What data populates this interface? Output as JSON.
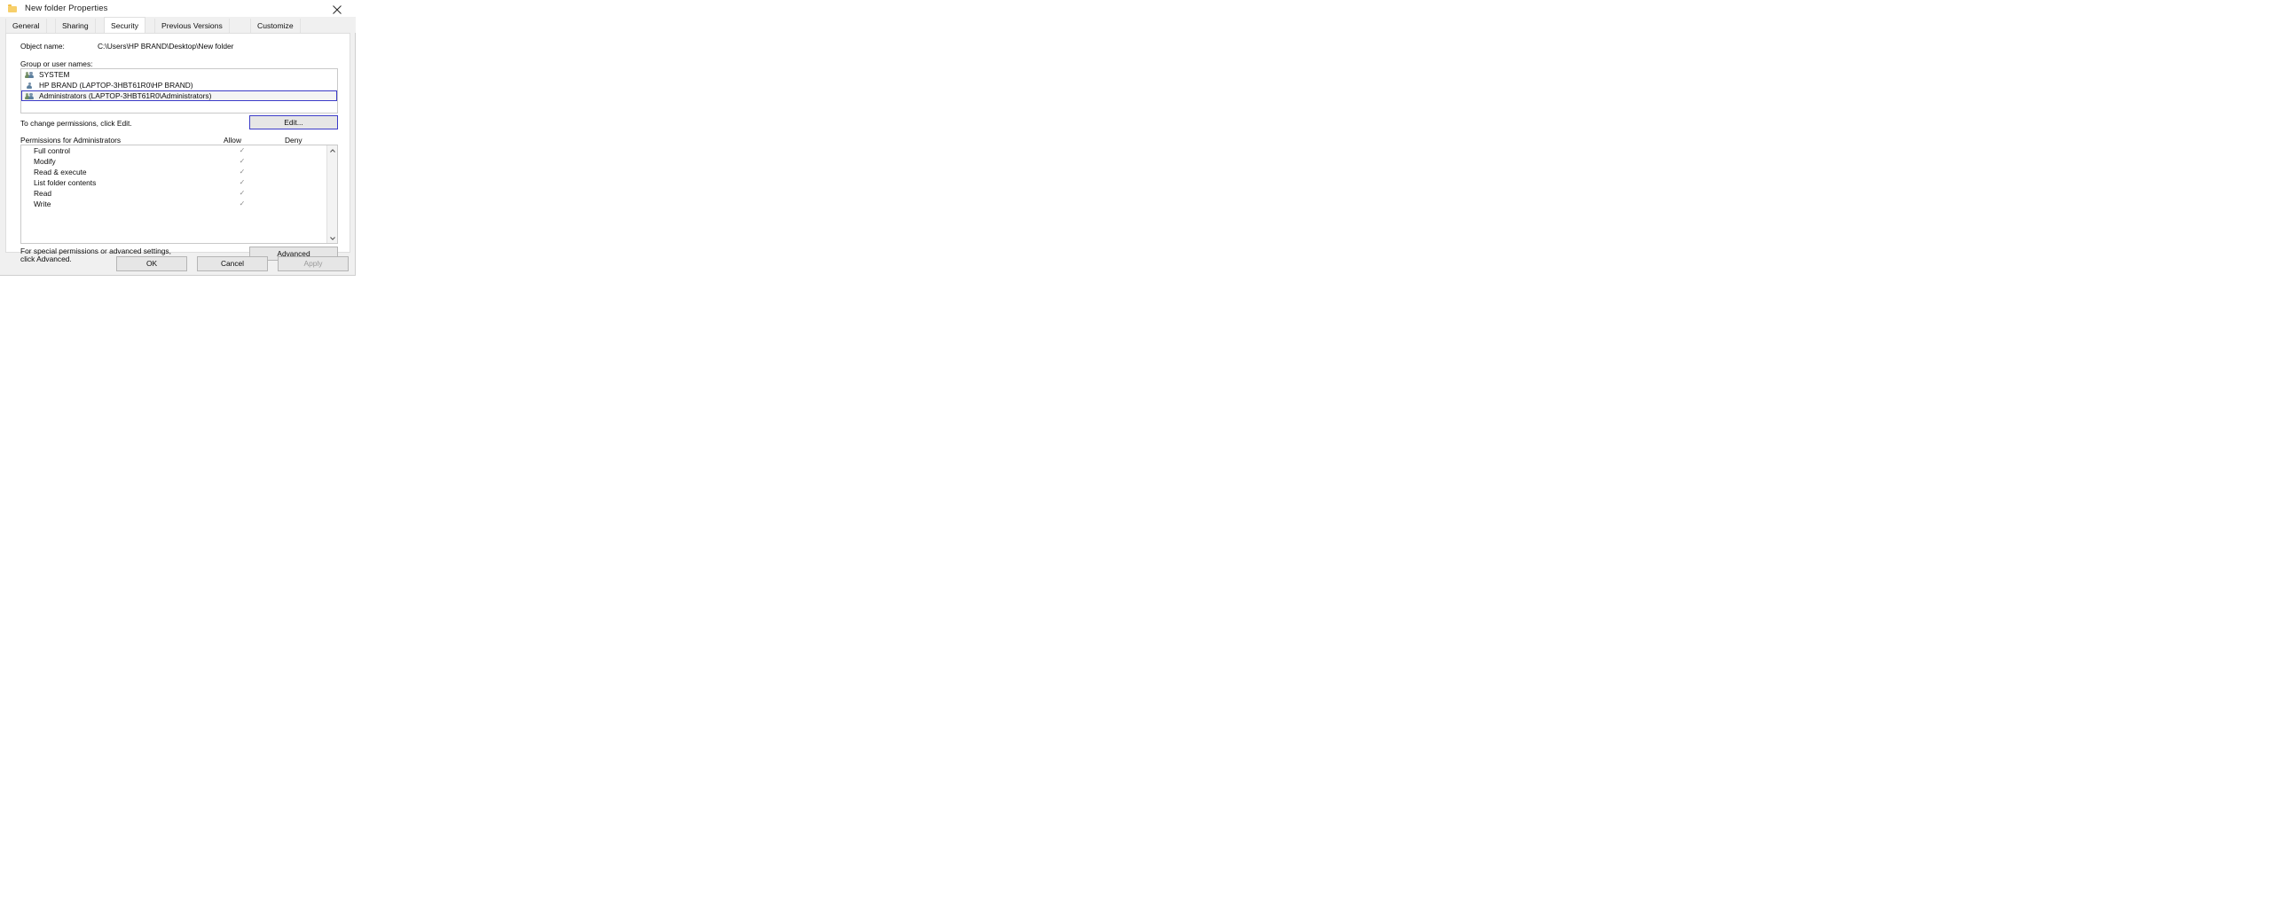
{
  "window": {
    "title": "New folder Properties",
    "icon": "folder-icon",
    "close_label": "✕"
  },
  "tabs": [
    {
      "label": "General",
      "active": false
    },
    {
      "label": "Sharing",
      "active": false
    },
    {
      "label": "Security",
      "active": true
    },
    {
      "label": "Previous Versions",
      "active": false
    },
    {
      "label": "Customize",
      "active": false
    }
  ],
  "security": {
    "object_name_label": "Object name:",
    "object_name_value": "C:\\Users\\HP BRAND\\Desktop\\New folder",
    "group_label": "Group or user names:",
    "group_users": [
      {
        "name": "SYSTEM",
        "icon": "group-users-icon",
        "selected": false
      },
      {
        "name": "HP BRAND (LAPTOP-3HBT61R0\\HP BRAND)",
        "icon": "single-user-icon",
        "selected": false
      },
      {
        "name": "Administrators (LAPTOP-3HBT61R0\\Administrators)",
        "icon": "group-users-icon",
        "selected": true
      }
    ],
    "edit_hint": "To change permissions, click Edit.",
    "edit_button": "Edit...",
    "permissions_title": "Permissions for Administrators",
    "col_allow": "Allow",
    "col_deny": "Deny",
    "permissions": [
      {
        "name": "Full control",
        "allow": "✓",
        "deny": ""
      },
      {
        "name": "Modify",
        "allow": "✓",
        "deny": ""
      },
      {
        "name": "Read & execute",
        "allow": "✓",
        "deny": ""
      },
      {
        "name": "List folder contents",
        "allow": "✓",
        "deny": ""
      },
      {
        "name": "Read",
        "allow": "✓",
        "deny": ""
      },
      {
        "name": "Write",
        "allow": "✓",
        "deny": ""
      }
    ],
    "advanced_hint_line1": "For special permissions or advanced settings,",
    "advanced_hint_line2": "click Advanced.",
    "advanced_button": "Advanced"
  },
  "footer": {
    "ok": "OK",
    "cancel": "Cancel",
    "apply": "Apply",
    "apply_disabled": true
  },
  "colors": {
    "selection_border": "#3b3bc8",
    "dialog_bg": "#f0f0f0",
    "panel_bg": "#ffffff",
    "check_mark": "#8b8b8b"
  }
}
